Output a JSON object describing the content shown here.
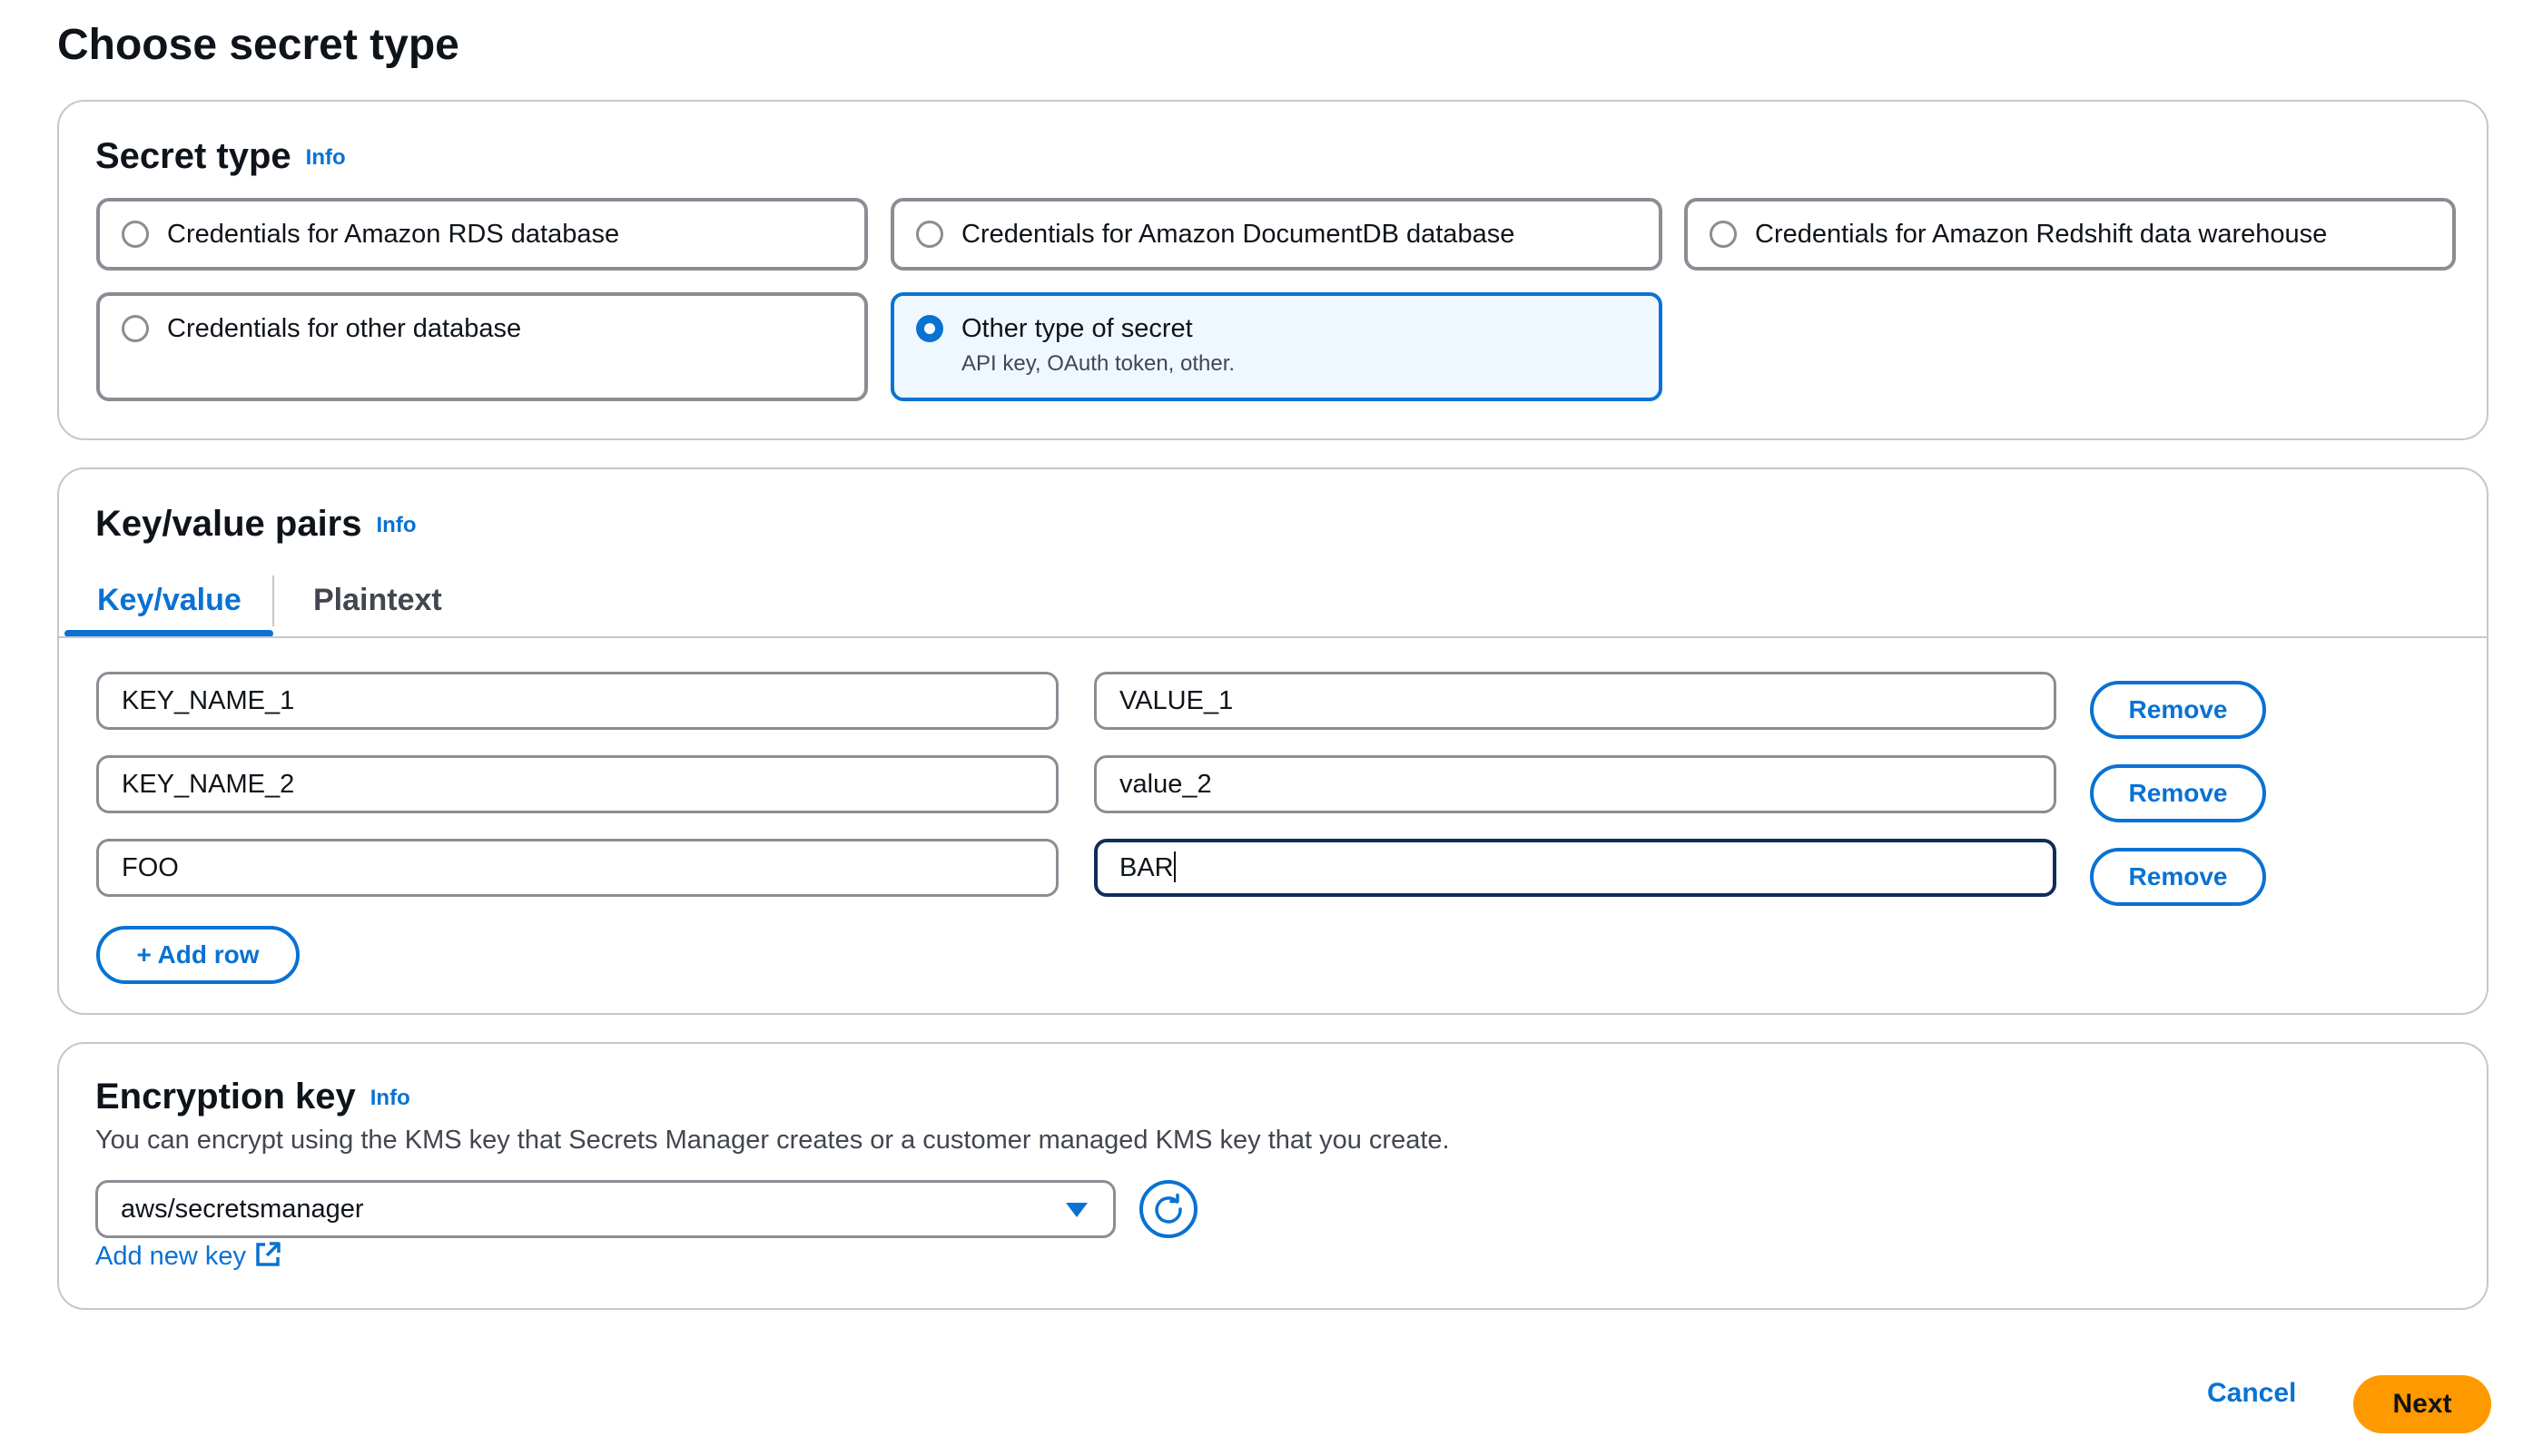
{
  "page": {
    "title": "Choose secret type"
  },
  "secret_type": {
    "title": "Secret type",
    "info": "Info",
    "options": [
      {
        "label": "Credentials for Amazon RDS database",
        "selected": false
      },
      {
        "label": "Credentials for Amazon DocumentDB database",
        "selected": false
      },
      {
        "label": "Credentials for Amazon Redshift data warehouse",
        "selected": false
      },
      {
        "label": "Credentials for other database",
        "selected": false
      },
      {
        "label": "Other type of secret",
        "description": "API key, OAuth token, other.",
        "selected": true
      }
    ]
  },
  "kv": {
    "title": "Key/value pairs",
    "info": "Info",
    "tabs": [
      {
        "label": "Key/value",
        "active": true
      },
      {
        "label": "Plaintext",
        "active": false
      }
    ],
    "rows": [
      {
        "key": "KEY_NAME_1",
        "value": "VALUE_1",
        "remove": "Remove"
      },
      {
        "key": "KEY_NAME_2",
        "value": "value_2",
        "remove": "Remove"
      },
      {
        "key": "FOO",
        "value": "BAR",
        "remove": "Remove",
        "focused": true
      }
    ],
    "add_row": "+ Add row"
  },
  "encryption": {
    "title": "Encryption key",
    "info": "Info",
    "description": "You can encrypt using the KMS key that Secrets Manager creates or a customer managed KMS key that you create.",
    "selected_key": "aws/secretsmanager",
    "add_new_key": "Add new key"
  },
  "footer": {
    "cancel": "Cancel",
    "next": "Next"
  },
  "colors": {
    "accent": "#0972d3",
    "primary_button": "#ff9900",
    "focus_border": "#0f2d5c"
  }
}
